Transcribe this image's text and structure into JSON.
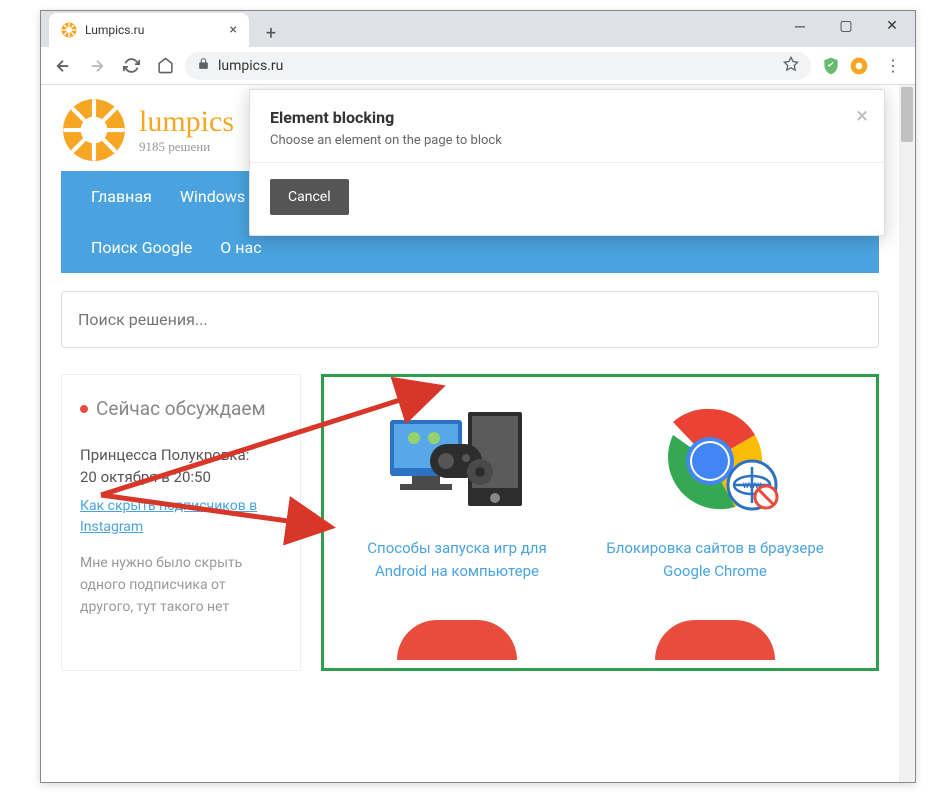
{
  "browser": {
    "tab_title": "Lumpics.ru",
    "url": "lumpics.ru"
  },
  "site": {
    "name": "lumpics",
    "tagline": "9185 решени"
  },
  "nav": {
    "items": [
      "Главная",
      "Windows",
      "Поиск Google",
      "О нас"
    ]
  },
  "search": {
    "placeholder": "Поиск решения..."
  },
  "sidebar": {
    "heading": "Сейчас обсуждаем",
    "comment": {
      "author": "Принцесса Полукровка:",
      "time": "20 октября в 20:50",
      "link": "Как скрыть подписчиков в Instagram",
      "body": "Мне нужно было скрыть одного подписчика от другого, тут такого нет"
    }
  },
  "cards": [
    {
      "title": "Способы запуска игр для Android на компьютере"
    },
    {
      "title": "Блокировка сайтов в браузере Google Chrome"
    }
  ],
  "modal": {
    "title": "Element blocking",
    "subtitle": "Choose an element on the page to block",
    "cancel": "Cancel"
  }
}
